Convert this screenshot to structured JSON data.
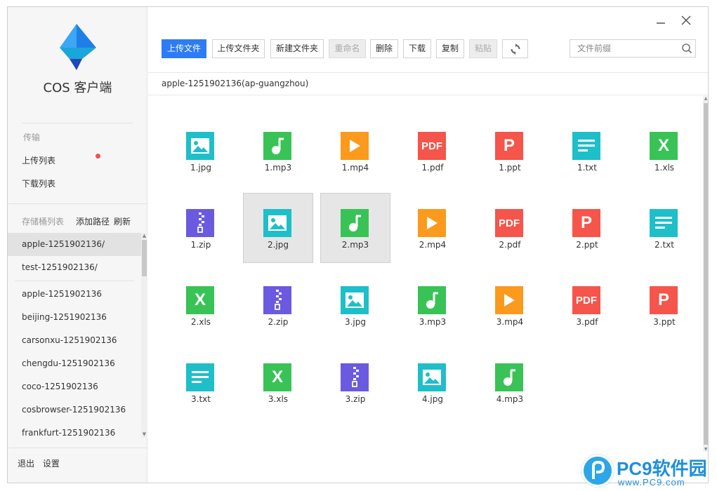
{
  "app": {
    "title": "COS 客户端"
  },
  "sidebar": {
    "transfer_label": "传输",
    "upload_list": "上传列表",
    "download_list": "下载列表",
    "bucket_list_label": "存储桶列表",
    "add_path": "添加路径",
    "refresh": "刷新",
    "saved_paths": [
      "apple-1251902136/",
      "test-1251902136/"
    ],
    "buckets": [
      "apple-1251902136",
      "beijing-1251902136",
      "carsonxu-1251902136",
      "chengdu-1251902136",
      "coco-1251902136",
      "cosbrowser-1251902136",
      "frankfurt-1251902136"
    ],
    "logout": "退出",
    "settings": "设置"
  },
  "toolbar": {
    "upload_file": "上传文件",
    "upload_folder": "上传文件夹",
    "new_folder": "新建文件夹",
    "rename": "重命名",
    "delete": "删除",
    "download": "下载",
    "copy": "复制",
    "paste": "粘贴"
  },
  "search": {
    "placeholder": "文件前缀"
  },
  "path": "apple-1251902136(ap-guangzhou)",
  "files": [
    {
      "name": "1.jpg",
      "type": "img"
    },
    {
      "name": "1.mp3",
      "type": "mp3"
    },
    {
      "name": "1.mp4",
      "type": "mp4"
    },
    {
      "name": "1.pdf",
      "type": "pdf"
    },
    {
      "name": "1.ppt",
      "type": "ppt"
    },
    {
      "name": "1.txt",
      "type": "txt"
    },
    {
      "name": "1.xls",
      "type": "xls"
    },
    {
      "name": "1.zip",
      "type": "zip"
    },
    {
      "name": "2.jpg",
      "type": "img",
      "selected": true
    },
    {
      "name": "2.mp3",
      "type": "mp3",
      "selected": true
    },
    {
      "name": "2.mp4",
      "type": "mp4"
    },
    {
      "name": "2.pdf",
      "type": "pdf"
    },
    {
      "name": "2.ppt",
      "type": "ppt"
    },
    {
      "name": "2.txt",
      "type": "txt"
    },
    {
      "name": "2.xls",
      "type": "xls"
    },
    {
      "name": "2.zip",
      "type": "zip"
    },
    {
      "name": "3.jpg",
      "type": "img"
    },
    {
      "name": "3.mp3",
      "type": "mp3"
    },
    {
      "name": "3.mp4",
      "type": "mp4"
    },
    {
      "name": "3.pdf",
      "type": "pdf"
    },
    {
      "name": "3.ppt",
      "type": "ppt"
    },
    {
      "name": "3.txt",
      "type": "txt"
    },
    {
      "name": "3.xls",
      "type": "xls"
    },
    {
      "name": "3.zip",
      "type": "zip"
    },
    {
      "name": "4.jpg",
      "type": "img"
    },
    {
      "name": "4.mp3",
      "type": "mp3"
    }
  ],
  "icon_text": {
    "pdf": "PDF",
    "ppt": "P",
    "xls": "X"
  },
  "colors": {
    "primary": "#2d7cf6",
    "image": "#1ebfc9",
    "audio": "#39c356",
    "video": "#fb9a1d",
    "doc_red": "#f5554a",
    "zip": "#6a5ae0",
    "badge": "#f25050"
  },
  "watermark": {
    "brand": "PC9软件园",
    "url": "www.PC9.com"
  }
}
